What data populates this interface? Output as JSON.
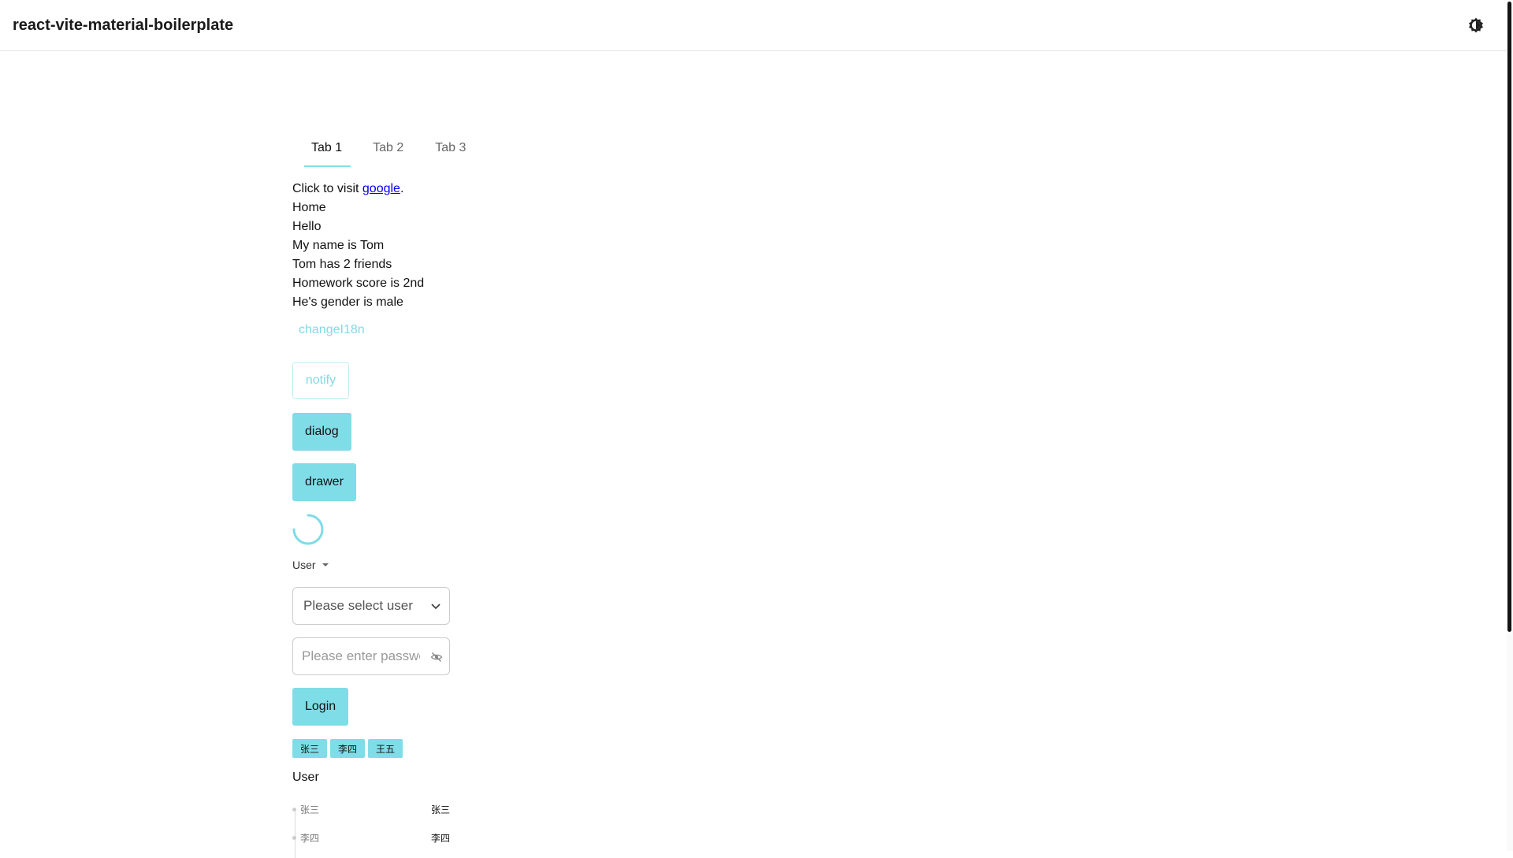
{
  "app": {
    "title": "react-vite-material-boilerplate",
    "theme_toggle_icon": "contrast-icon"
  },
  "tabs": [
    {
      "label": "Tab 1"
    },
    {
      "label": "Tab 2"
    },
    {
      "label": "Tab 3"
    }
  ],
  "content": {
    "visit_prefix": "Click to visit ",
    "visit_link": "google",
    "visit_suffix": ".",
    "line_home": "Home",
    "line_hello": "Hello",
    "line_name": "My name is Tom",
    "line_friends": "Tom has 2 friends",
    "line_score": "Homework score is 2nd",
    "line_gender": "He's gender is male"
  },
  "buttons": {
    "change_i18n": "changeI18n",
    "notify": "notify",
    "dialog": "dialog",
    "drawer": "drawer",
    "login": "Login"
  },
  "user_dropdown": {
    "label": "User"
  },
  "select": {
    "placeholder": "Please select user"
  },
  "password": {
    "placeholder": "Please enter password"
  },
  "chips": [
    {
      "label": "张三"
    },
    {
      "label": "李四"
    },
    {
      "label": "王五"
    }
  ],
  "user_section": {
    "heading": "User",
    "rows": [
      {
        "label": "张三",
        "value": "张三"
      },
      {
        "label": "李四",
        "value": "李四"
      }
    ]
  },
  "colors": {
    "accent": "#7fdde8",
    "link": "#0000ee"
  }
}
